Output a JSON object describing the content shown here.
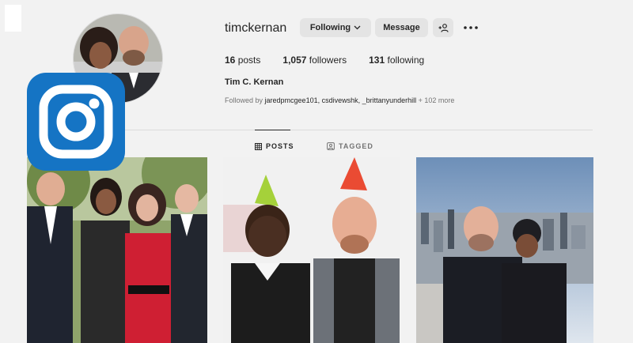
{
  "profile": {
    "username": "timckernan",
    "full_name": "Tim C. Kernan",
    "following_label": "Following",
    "message_label": "Message",
    "stats": {
      "posts_count": "16",
      "posts_label": "posts",
      "followers_count": "1,057",
      "followers_label": "followers",
      "following_count": "131",
      "following_label": "following"
    },
    "followed_by_prefix": "Followed by ",
    "followed_by_names": "jaredpmcgee101, csdivewshk, _brittanyunderhill",
    "followed_by_more": " + 102 more"
  },
  "tabs": {
    "posts_label": "POSTS",
    "tagged_label": "TAGGED"
  },
  "overlay": {
    "logo_icon": "instagram-icon",
    "logo_color": "#1574c4"
  },
  "colors": {
    "background": "#f2f2f2",
    "button_bg": "#e4e4e4",
    "text": "#262626",
    "muted_text": "#737373"
  }
}
